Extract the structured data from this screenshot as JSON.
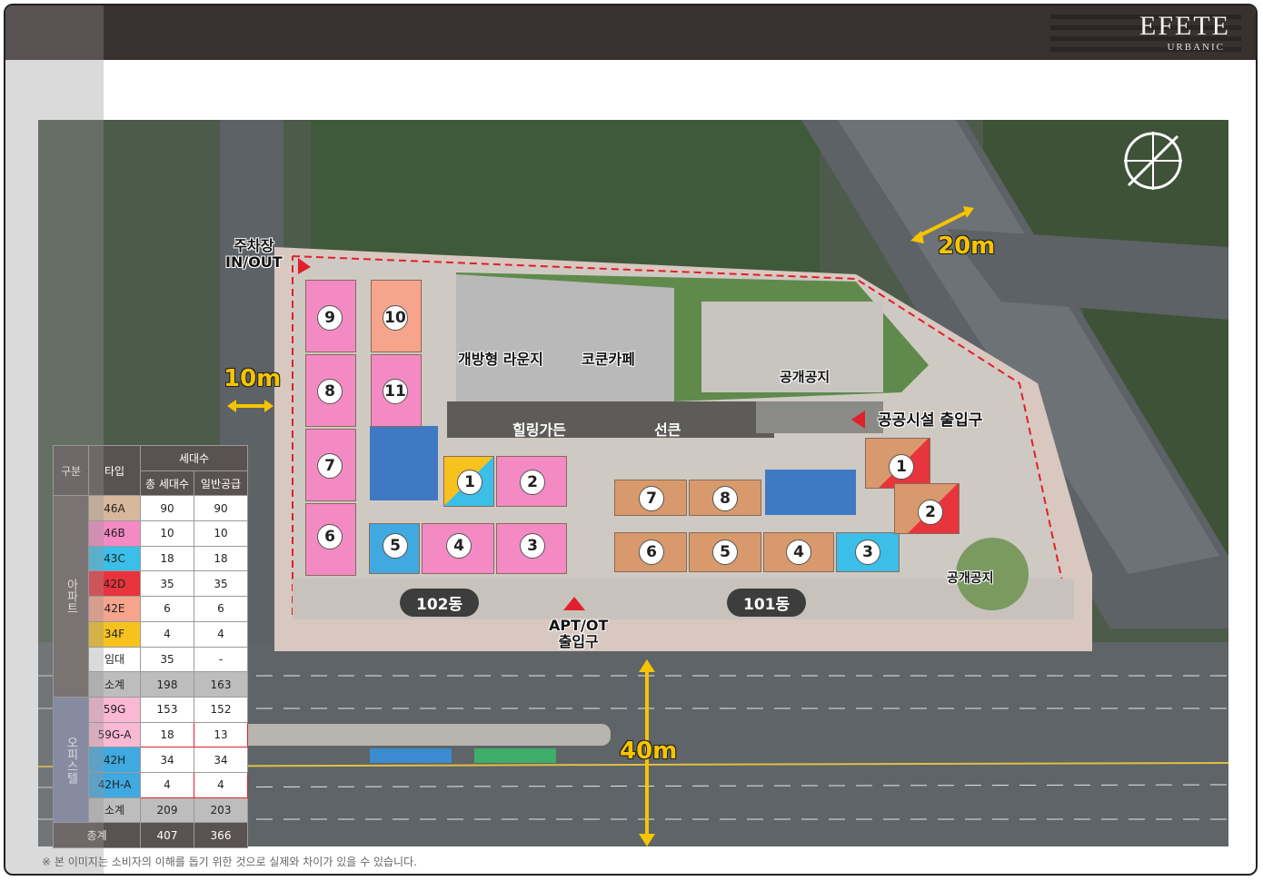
{
  "brand": {
    "name": "EFETE",
    "sub": "URBANIC"
  },
  "compass": {
    "label": "N"
  },
  "map_labels": {
    "parking_entrance": [
      "주차장",
      "IN/OUT"
    ],
    "road_10m": "10m",
    "road_20m": "20m",
    "road_40m": "40m",
    "open_lounge": "개방형 라운지",
    "kokun_cafe": "코쿤카페",
    "public_space_1": "공개공지",
    "public_space_2": "공개공지",
    "healing_garden": "힐링가든",
    "sunken": "선큰",
    "public_facility_entrance": "공공시설 출입구",
    "apt_ot_entrance": [
      "APT/OT",
      "출입구"
    ],
    "dong_102": "102동",
    "dong_101": "101동"
  },
  "unit_numbers": {
    "b102_left": [
      "9",
      "10",
      "8",
      "11",
      "7",
      "6"
    ],
    "b102_bottom": [
      "1",
      "2",
      "5",
      "4",
      "3"
    ],
    "b101_bottom": [
      "7",
      "8",
      "6",
      "5",
      "4",
      "3"
    ],
    "b101_right": [
      "1",
      "2"
    ]
  },
  "table": {
    "headers": {
      "category": "구분",
      "type": "타입",
      "households": "세대수",
      "total": "총 세대수",
      "general": "일반공급"
    },
    "groups": [
      {
        "name": "아파트",
        "rows": [
          {
            "type": "46A",
            "total": "90",
            "general": "90",
            "color": "#d8b89c"
          },
          {
            "type": "46B",
            "total": "10",
            "general": "10",
            "color": "#f48ac4"
          },
          {
            "type": "43C",
            "total": "18",
            "general": "18",
            "color": "#3bbfe8"
          },
          {
            "type": "42D",
            "total": "35",
            "general": "35",
            "color": "#e8343c"
          },
          {
            "type": "42E",
            "total": "6",
            "general": "6",
            "color": "#f7a48c"
          },
          {
            "type": "34F",
            "total": "4",
            "general": "4",
            "color": "#f7c21e"
          },
          {
            "type": "임대",
            "total": "35",
            "general": "-",
            "color": "#ffffff"
          }
        ],
        "subtotal": {
          "label": "소계",
          "total": "198",
          "general": "163"
        }
      },
      {
        "name": "오피스텔",
        "rows": [
          {
            "type": "59G",
            "total": "153",
            "general": "152",
            "color": "#f9b8d4"
          },
          {
            "type": "59G-A",
            "total": "18",
            "general": "13",
            "color": "#f9b8d4"
          },
          {
            "type": "42H",
            "total": "34",
            "general": "34",
            "color": "#3fa9e0"
          },
          {
            "type": "42H-A",
            "total": "4",
            "general": "4",
            "color": "#3fa9e0"
          }
        ],
        "subtotal": {
          "label": "소계",
          "total": "209",
          "general": "203"
        }
      }
    ],
    "grand_total": {
      "label": "총계",
      "total": "407",
      "general": "366"
    }
  },
  "footnote": "※ 본 이미지는 소비자의 이해를 돕기 위한 것으로 실제와 차이가 있을 수 있습니다."
}
